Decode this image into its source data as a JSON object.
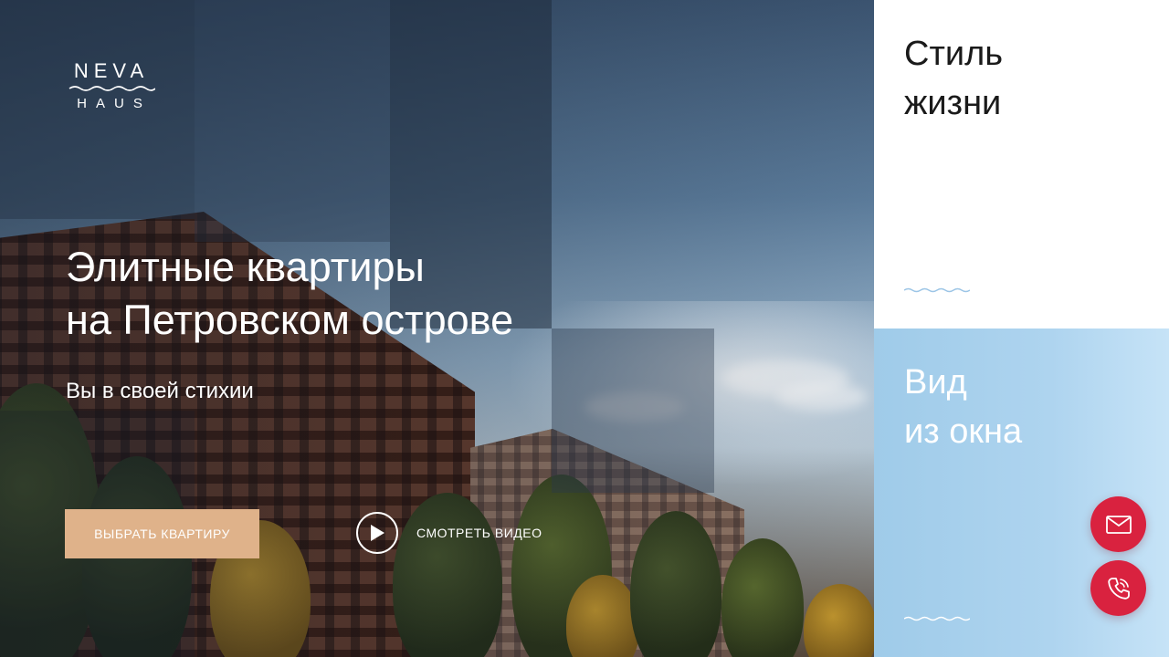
{
  "brand": {
    "name_top": "NEVA",
    "name_bottom": "HAUS"
  },
  "hero": {
    "headline_line1": "Элитные квартиры",
    "headline_line2": "на Петровском острове",
    "subheadline": "Вы в своей стихии",
    "cta_label": "Выбрать квартиру",
    "video_label": "Смотреть видео"
  },
  "cards": [
    {
      "title_line1": "Стиль",
      "title_line2": "жизни"
    },
    {
      "title_line1": "Вид",
      "title_line2": "из окна"
    }
  ],
  "actions": {
    "mail_icon": "mail-icon",
    "phone_icon": "phone-icon"
  },
  "colors": {
    "accent_button": "#dfb28a",
    "fab": "#d9223f",
    "card_blue": "#aed4ef",
    "wave_line": "#9cc5e6"
  }
}
